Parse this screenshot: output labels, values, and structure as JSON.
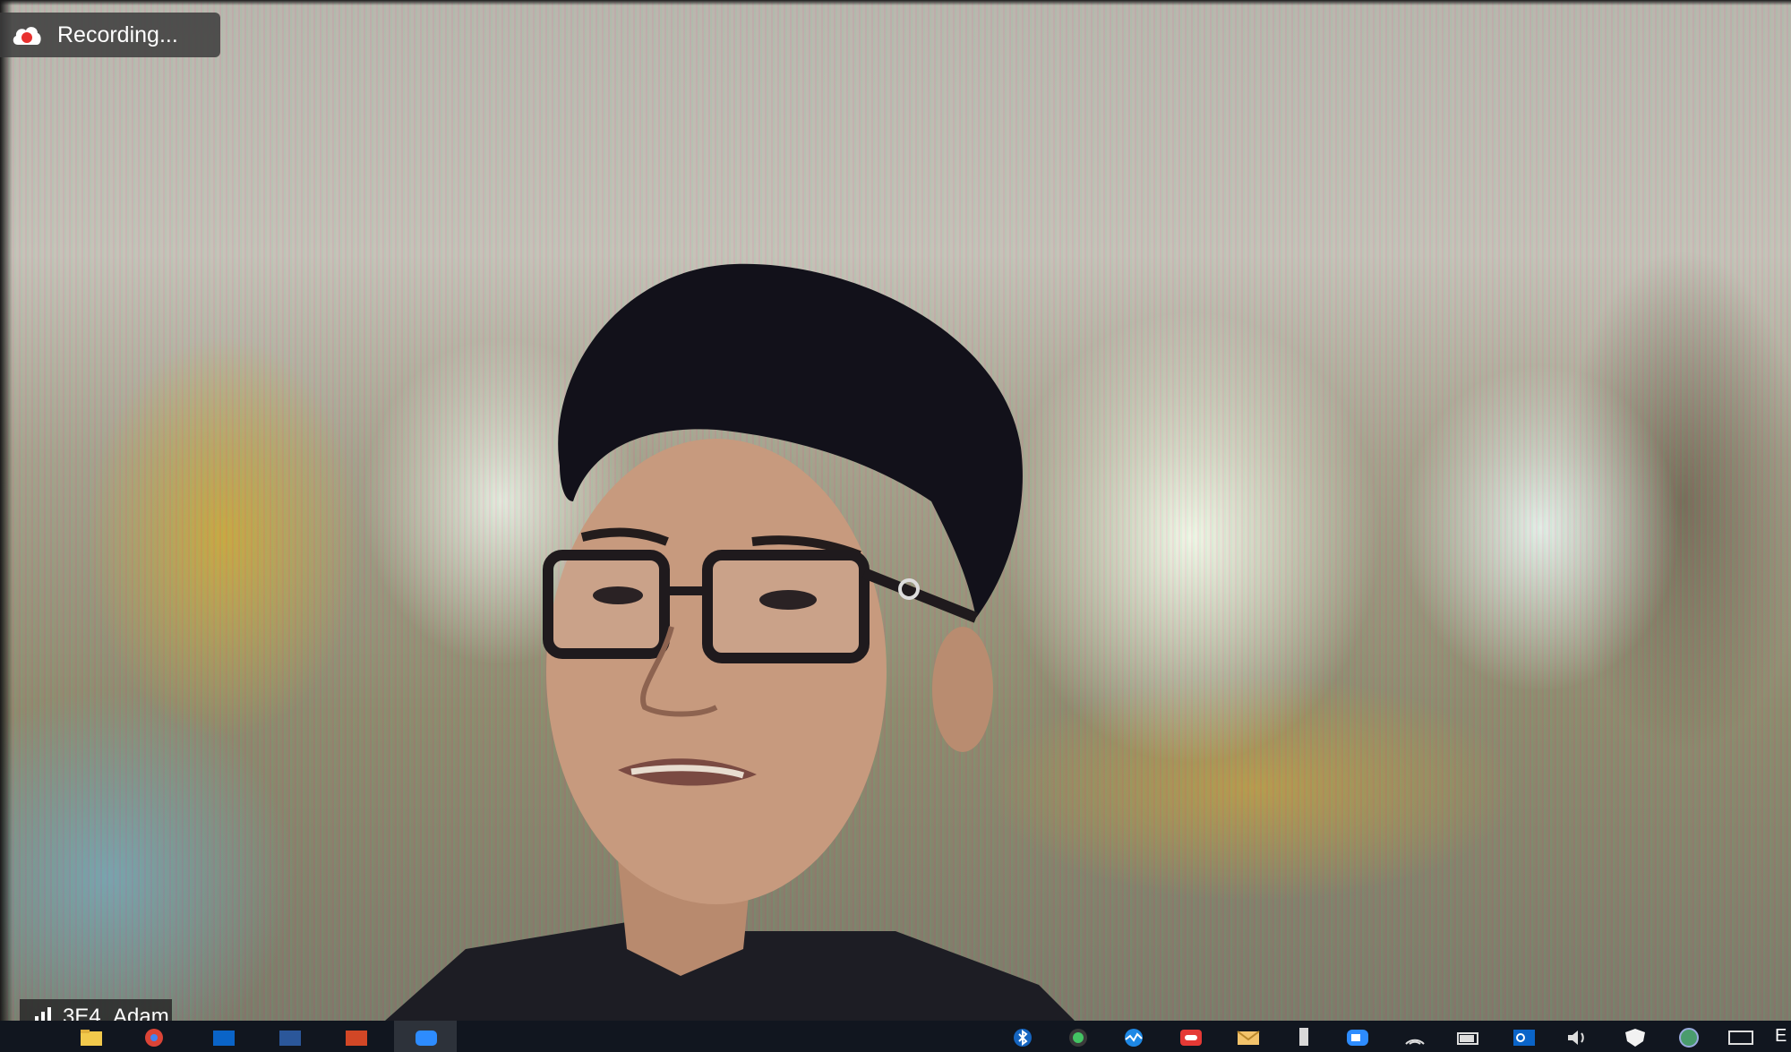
{
  "recording": {
    "label": "Recording...",
    "icon": "recording-cloud-icon",
    "icon_color": "#e8312f"
  },
  "participant": {
    "name": "3E4_Adam",
    "icon": "signal-strength-icon"
  },
  "taskbar": {
    "pinned_icons": [
      "file-explorer-icon",
      "chrome-icon",
      "outlook-icon",
      "word-icon",
      "powerpoint-icon",
      "zoom-icon"
    ],
    "tray_icons": [
      "bluetooth-icon",
      "green-shield-icon",
      "performance-monitor-icon",
      "red-app-icon",
      "mail-icon",
      "usb-drive-icon",
      "zoom-tray-icon",
      "wifi-icon",
      "battery-icon",
      "outlook-tray-icon",
      "volume-icon",
      "security-shield-icon",
      "globe-icon",
      "keyboard-icon"
    ],
    "language_indicator": "E"
  },
  "colors": {
    "taskbar_bg": "#11161f",
    "badge_bg": "#3c3c3c",
    "zoom_blue": "#2d8cff"
  }
}
